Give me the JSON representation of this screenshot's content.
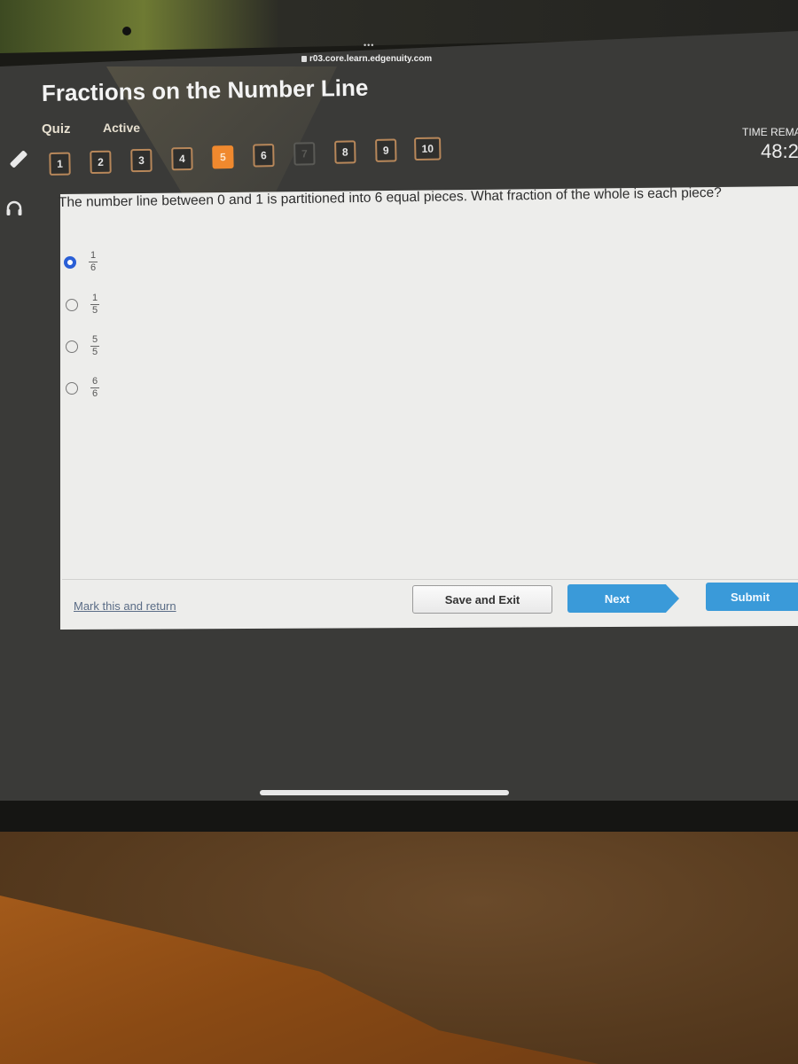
{
  "browser": {
    "dots": "•••",
    "url": "r03.core.learn.edgenuity.com"
  },
  "header": {
    "title": "Fractions on the Number Line",
    "type_label": "Quiz",
    "status_label": "Active",
    "time_label": "TIME REMA",
    "time_value": "48:2"
  },
  "question_nav": {
    "items": [
      {
        "label": "1",
        "state": "answered"
      },
      {
        "label": "2",
        "state": "answered"
      },
      {
        "label": "3",
        "state": "answered"
      },
      {
        "label": "4",
        "state": "answered"
      },
      {
        "label": "5",
        "state": "current"
      },
      {
        "label": "6",
        "state": "answered"
      },
      {
        "label": "7",
        "state": "disabled"
      },
      {
        "label": "8",
        "state": "answered"
      },
      {
        "label": "9",
        "state": "answered"
      },
      {
        "label": "10",
        "state": "answered"
      }
    ]
  },
  "sidebar_tools": [
    "pencil-icon",
    "headphones-icon"
  ],
  "question": {
    "text": "The number line between 0 and 1 is partitioned into 6 equal pieces. What fraction of the whole is each piece?",
    "options": [
      {
        "numerator": "1",
        "denominator": "6",
        "selected": true
      },
      {
        "numerator": "1",
        "denominator": "5",
        "selected": false
      },
      {
        "numerator": "5",
        "denominator": "5",
        "selected": false
      },
      {
        "numerator": "6",
        "denominator": "6",
        "selected": false
      }
    ]
  },
  "footer": {
    "mark_link": "Mark this and return",
    "save_label": "Save and Exit",
    "next_label": "Next",
    "submit_label": "Submit"
  },
  "colors": {
    "current_question": "#f0892e",
    "nav_border": "#b7875a",
    "primary_button": "#3a9ad9",
    "selected_radio": "#2a5fd6"
  }
}
